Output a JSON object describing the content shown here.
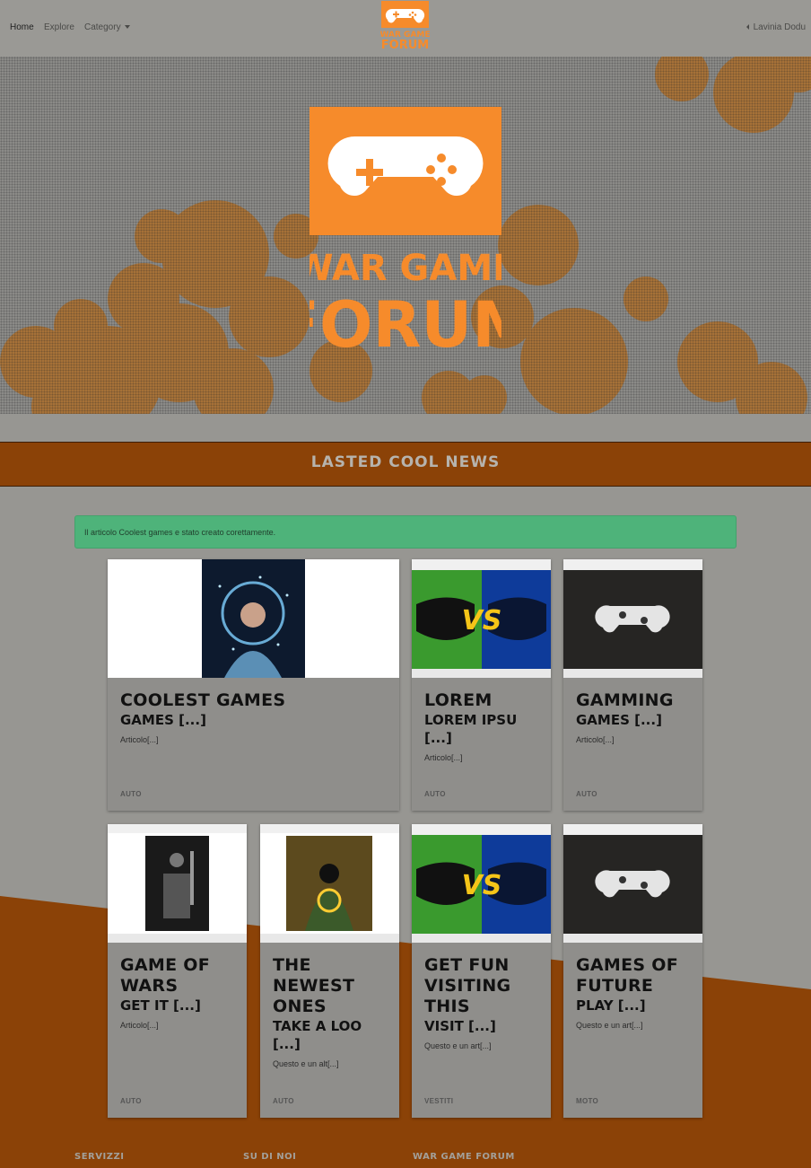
{
  "nav": {
    "home": "Home",
    "explore": "Explore",
    "category": "Category",
    "user": "Lavinia Dodu",
    "logo_line1": "WAR GAME",
    "logo_line2": "FORUM"
  },
  "hero": {
    "logo_line1": "WAR GAME",
    "logo_line2": "FORUM"
  },
  "section": {
    "title": "LASTED COOL NEWS"
  },
  "alert": {
    "message": "Il articolo Coolest games e stato creato corettamente."
  },
  "cards": [
    {
      "title": "Coolest games",
      "subtitle": "games [...]",
      "excerpt": "Articolo[...]",
      "category": "AUTO",
      "image": "woman-sparkler-photo"
    },
    {
      "title": "Lorem",
      "subtitle": "Lorem ipsu [...]",
      "excerpt": "Articolo[...]",
      "category": "AUTO",
      "image": "versus-controllers"
    },
    {
      "title": "Gamming",
      "subtitle": "games [...]",
      "excerpt": "Articolo[...]",
      "category": "AUTO",
      "image": "white-controller"
    },
    {
      "title": "Game of wars",
      "subtitle": "get it [...]",
      "excerpt": "Articolo[...]",
      "category": "AUTO",
      "image": "armored-warrior"
    },
    {
      "title": "The newest ones",
      "subtitle": "Take a loo [...]",
      "excerpt": "Questo e un alt[...]",
      "category": "AUTO",
      "image": "hooded-hacker"
    },
    {
      "title": "Get fun visiting this",
      "subtitle": "visit [...]",
      "excerpt": "Questo e un art[...]",
      "category": "VESTITI",
      "image": "versus-controllers"
    },
    {
      "title": "Games of future",
      "subtitle": "play [...]",
      "excerpt": "Questo e un art[...]",
      "category": "MOTO",
      "image": "white-controller"
    }
  ],
  "footer": {
    "col1": "SERVIZZI",
    "col2": "SU DI NOI",
    "col3": "WAR GAME FORUM"
  },
  "colors": {
    "brand_orange": "#f68b2b",
    "banner_brown": "#8b4207",
    "alert_green": "#4eb37a",
    "page_gray": "#979692"
  }
}
